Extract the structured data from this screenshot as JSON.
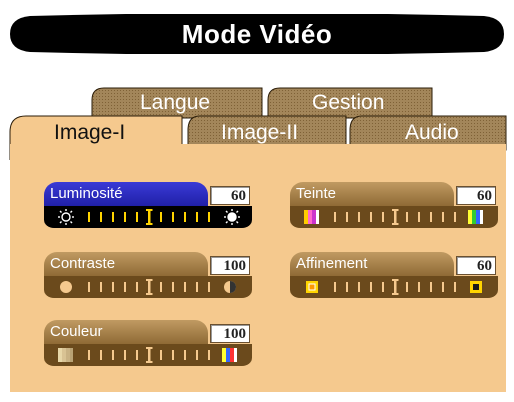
{
  "title": "Mode Vidéo",
  "tabs": {
    "back_row": [
      "Langue",
      "Gestion"
    ],
    "front_row": [
      "Image-I",
      "Image-II",
      "Audio"
    ],
    "active": "Image-I"
  },
  "controls": [
    {
      "id": "luminosite",
      "label": "Luminosité",
      "value": "60",
      "level": 0.5,
      "active": true,
      "left_icon": "sun-outline-icon",
      "right_icon": "sun-filled-icon"
    },
    {
      "id": "contraste",
      "label": "Contraste",
      "value": "100",
      "level": 0.5,
      "active": false,
      "left_icon": "circle-filled-icon",
      "right_icon": "half-circle-icon"
    },
    {
      "id": "couleur",
      "label": "Couleur",
      "value": "100",
      "level": 0.5,
      "active": false,
      "left_icon": "color-dim-icon",
      "right_icon": "color-bright-icon"
    },
    {
      "id": "teinte",
      "label": "Teinte",
      "value": "60",
      "level": 0.5,
      "active": false,
      "left_icon": "tint-left-icon",
      "right_icon": "tint-right-icon"
    },
    {
      "id": "affinement",
      "label": "Affinement",
      "value": "60",
      "level": 0.5,
      "active": false,
      "left_icon": "sharp-soft-icon",
      "right_icon": "sharp-hard-icon"
    }
  ],
  "colors": {
    "panel": "#f5c98e",
    "tab_face": "#9a7b4e",
    "active_header": "#2a2ac0",
    "accent_marker": "#ffd400"
  }
}
